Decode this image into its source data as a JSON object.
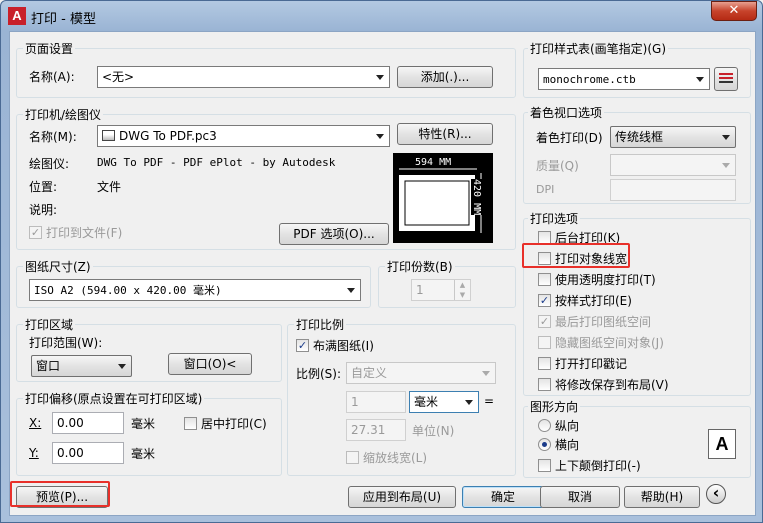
{
  "window": {
    "title": "打印 - 模型",
    "app_icon": "A",
    "close": "✕"
  },
  "page_setup": {
    "group": "页面设置",
    "name_label": "名称(A):",
    "name_value": "<无>",
    "add_button": "添加(.)..."
  },
  "printer": {
    "group": "打印机/绘图仪",
    "name_label": "名称(M):",
    "name_value": "DWG To PDF.pc3",
    "properties_button": "特性(R)...",
    "plotter_label": "绘图仪:",
    "plotter_value": "DWG To PDF - PDF ePlot - by Autodesk",
    "location_label": "位置:",
    "location_value": "文件",
    "description_label": "说明:",
    "plot_to_file": "打印到文件(F)",
    "pdf_options_button": "PDF 选项(O)...",
    "preview_width": "594 MM",
    "preview_height": "420 MM"
  },
  "paper_size": {
    "group": "图纸尺寸(Z)",
    "value": "ISO A2 (594.00 x 420.00 毫米)"
  },
  "copies": {
    "group": "打印份数(B)",
    "value": "1"
  },
  "plot_area": {
    "group": "打印区域",
    "range_label": "打印范围(W):",
    "range_value": "窗口",
    "window_button": "窗口(O)<"
  },
  "plot_offset": {
    "group": "打印偏移(原点设置在可打印区域)",
    "x_label": "X:",
    "x_value": "0.00",
    "x_unit": "毫米",
    "y_label": "Y:",
    "y_value": "0.00",
    "y_unit": "毫米",
    "center_plot": "居中打印(C)"
  },
  "plot_scale": {
    "group": "打印比例",
    "fit_paper": "布满图纸(I)",
    "scale_label": "比例(S):",
    "scale_value": "自定义",
    "value1": "1",
    "unit_value": "毫米",
    "equals": "=",
    "value2": "27.31",
    "unit_label": "单位(N)",
    "scale_lineweights": "缩放线宽(L)"
  },
  "plot_style_table": {
    "group": "打印样式表(画笔指定)(G)",
    "value": "monochrome.ctb"
  },
  "shaded_viewport": {
    "group": "着色视口选项",
    "shade_label": "着色打印(D)",
    "shade_value": "传统线框",
    "quality_label": "质量(Q)",
    "dpi_label": "DPI"
  },
  "plot_options": {
    "group": "打印选项",
    "items": [
      {
        "label": "后台打印(K)",
        "checked": false,
        "enabled": true
      },
      {
        "label": "打印对象线宽",
        "checked": false,
        "enabled": true
      },
      {
        "label": "使用透明度打印(T)",
        "checked": false,
        "enabled": true
      },
      {
        "label": "按样式打印(E)",
        "checked": true,
        "enabled": true
      },
      {
        "label": "最后打印图纸空间",
        "checked": true,
        "enabled": false
      },
      {
        "label": "隐藏图纸空间对象(J)",
        "checked": false,
        "enabled": false
      },
      {
        "label": "打开打印戳记",
        "checked": false,
        "enabled": true
      },
      {
        "label": "将修改保存到布局(V)",
        "checked": false,
        "enabled": true
      }
    ]
  },
  "orientation": {
    "group": "图形方向",
    "portrait": "纵向",
    "landscape": "横向",
    "upside_down": "上下颠倒打印(-)",
    "icon_letter": "A"
  },
  "footer": {
    "preview": "预览(P)...",
    "apply_layout": "应用到布局(U)",
    "ok": "确定",
    "cancel": "取消",
    "help": "帮助(H)",
    "expand": "‹"
  },
  "icons": {
    "check": "✓"
  },
  "colors": {
    "highlight": "#e8302a",
    "title_bg": "#9ab4d4",
    "close": "#c7432b"
  }
}
